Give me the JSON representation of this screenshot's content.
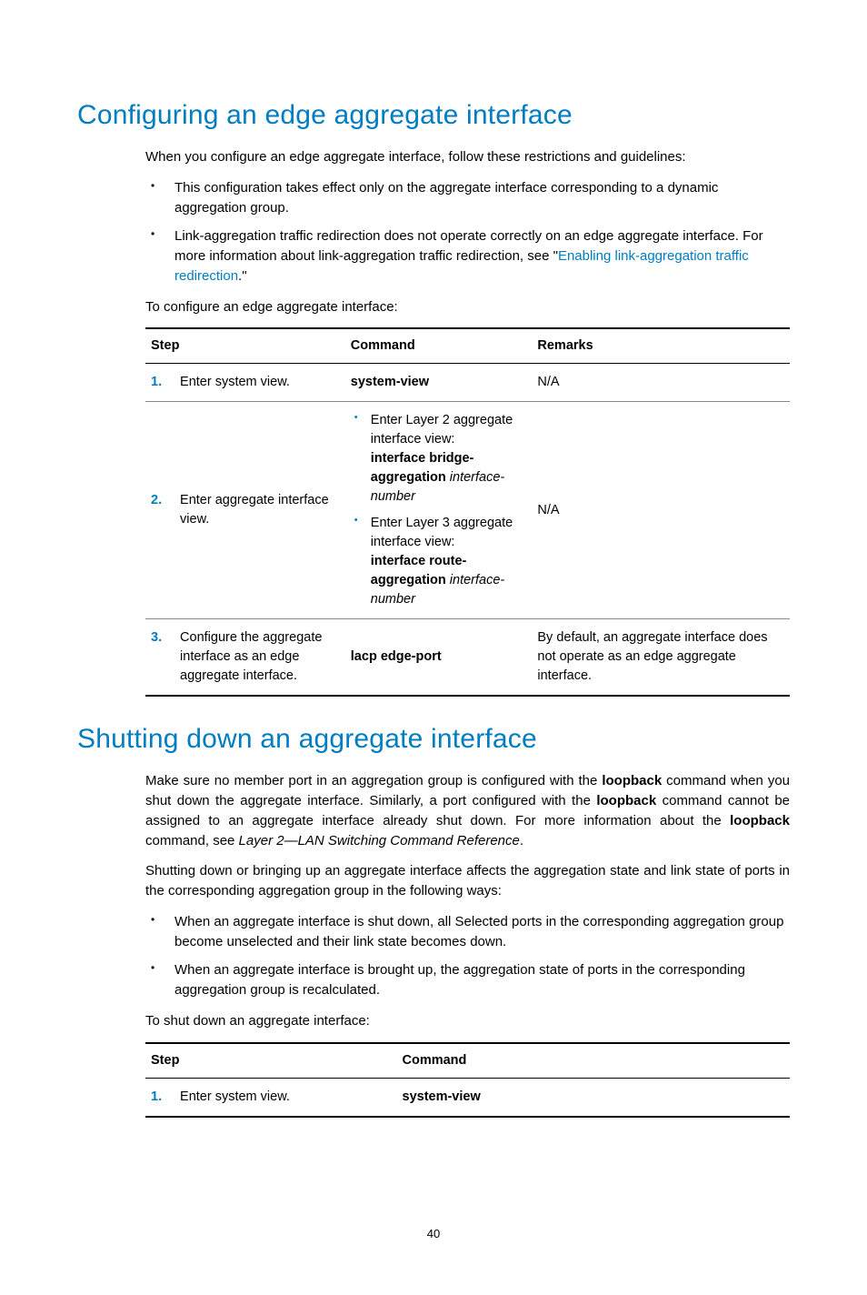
{
  "section1": {
    "title": "Configuring an edge aggregate interface",
    "intro": "When you configure an edge aggregate interface, follow these restrictions and guidelines:",
    "bullet1": "This configuration takes effect only on the aggregate interface corresponding to a dynamic aggregation group.",
    "bullet2_a": "Link-aggregation traffic redirection does not operate correctly on an edge aggregate interface. For more information about link-aggregation traffic redirection, see \"",
    "bullet2_link": "Enabling link-aggregation traffic redirection",
    "bullet2_b": ".\"",
    "lead2": "To configure an edge aggregate interface:",
    "headers": {
      "step": "Step",
      "command": "Command",
      "remarks": "Remarks"
    },
    "row1": {
      "num": "1.",
      "step": "Enter system view.",
      "cmd": "system-view",
      "remarks": "N/A"
    },
    "row2": {
      "num": "2.",
      "step": "Enter aggregate interface view.",
      "cmd_a1": "Enter Layer 2 aggregate interface view:",
      "cmd_a2_bold": "interface bridge-aggregation",
      "cmd_a2_ital": "interface-number",
      "cmd_b1": "Enter Layer 3 aggregate interface view:",
      "cmd_b2_bold": "interface route-aggregation",
      "cmd_b2_ital": "interface-number",
      "remarks": "N/A"
    },
    "row3": {
      "num": "3.",
      "step": "Configure the aggregate interface as an edge aggregate interface.",
      "cmd": "lacp edge-port",
      "remarks": "By default, an aggregate interface does not operate as an edge aggregate interface."
    }
  },
  "section2": {
    "title": "Shutting down an aggregate interface",
    "para1_a": "Make sure no member port in an aggregation group is configured with the ",
    "para1_loop": "loopback",
    "para1_b": " command when you shut down the aggregate interface. Similarly, a port configured with the ",
    "para1_c": " command cannot be assigned to an aggregate interface already shut down. For more information about the ",
    "para1_d": " command, see ",
    "para1_ref": "Layer 2—LAN Switching Command Reference",
    "para1_e": ".",
    "para2": "Shutting down or bringing up an aggregate interface affects the aggregation state and link state of ports in the corresponding aggregation group in the following ways:",
    "bullet1": "When an aggregate interface is shut down, all Selected ports in the corresponding aggregation group become unselected and their link state becomes down.",
    "bullet2": "When an aggregate interface is brought up, the aggregation state of ports in the corresponding aggregation group is recalculated.",
    "lead": "To shut down an aggregate interface:",
    "headers": {
      "step": "Step",
      "command": "Command"
    },
    "row1": {
      "num": "1.",
      "step": "Enter system view.",
      "cmd": "system-view"
    }
  },
  "page_number": "40"
}
